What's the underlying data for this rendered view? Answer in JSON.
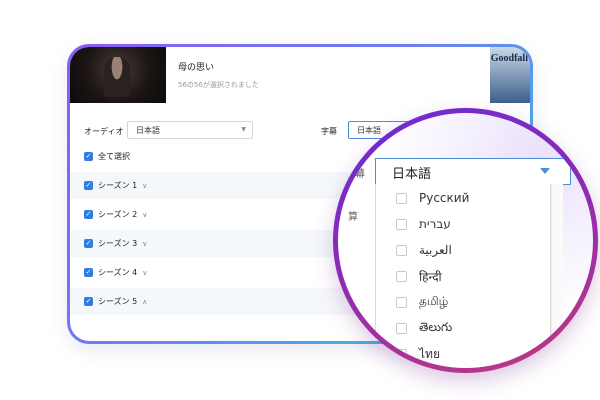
{
  "media": {
    "title": "母の思い",
    "selection_status": "56の56が選択されました",
    "poster_text": "Goodfall"
  },
  "controls": {
    "audio_label": "オーディオ",
    "audio_value": "日本語",
    "subtitle_label": "字幕",
    "subtitle_value": "日本語"
  },
  "select_all_label": "全て選択",
  "seasons": [
    {
      "label": "シーズン 1",
      "chevron": "∨"
    },
    {
      "label": "シーズン 2",
      "chevron": "∨"
    },
    {
      "label": "シーズン 3",
      "chevron": "∨"
    },
    {
      "label": "シーズン 4",
      "chevron": "∨"
    },
    {
      "label": "シーズン 5",
      "chevron": "∧"
    }
  ],
  "magnifier": {
    "side_label": "幕",
    "selected": "日本語",
    "partial_text": "算",
    "options": [
      "Русский",
      "עברית",
      "العربية",
      "हिन्दी",
      "தமிழ்",
      "తెలుగు",
      "ไทย"
    ]
  },
  "colors": {
    "accent": "#2f7de1",
    "frame_start": "#8a5cf6",
    "frame_end": "#2ecbd6",
    "lens_start": "#6a2bd6",
    "lens_end": "#c23a7d"
  }
}
